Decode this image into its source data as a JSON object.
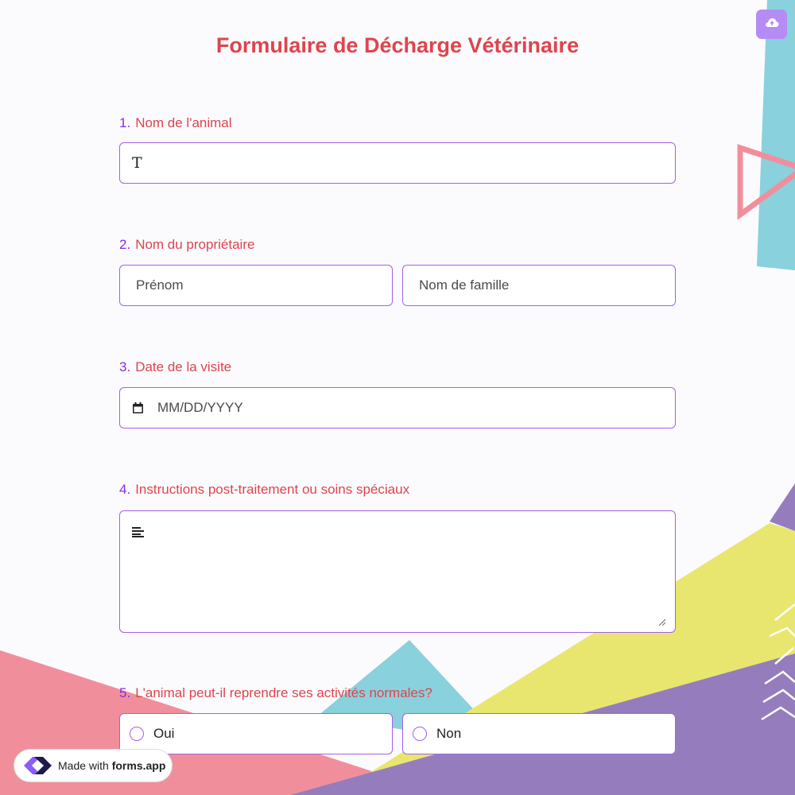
{
  "form": {
    "title": "Formulaire de Décharge Vétérinaire"
  },
  "questions": [
    {
      "number": "1.",
      "label": "Nom de l'animal"
    },
    {
      "number": "2.",
      "label": "Nom du propriétaire",
      "first_placeholder": "Prénom",
      "last_placeholder": "Nom de famille"
    },
    {
      "number": "3.",
      "label": "Date de la visite",
      "placeholder": "MM/DD/YYYY"
    },
    {
      "number": "4.",
      "label": "Instructions post-traitement ou soins spéciaux"
    },
    {
      "number": "5.",
      "label": "L'animal peut-il reprendre ses activités normales?",
      "options": [
        "Oui",
        "Non"
      ]
    }
  ],
  "branding": {
    "prefix": "Made with",
    "name": "forms.app"
  },
  "colors": {
    "accent": "#a65ee8",
    "label": "#e0434d",
    "number": "#8a2be2",
    "shape_teal": "#89d1dc",
    "shape_pink": "#f08f9b",
    "shape_yellow": "#e8e66f",
    "shape_purple": "#957dbd"
  },
  "icons": {
    "text_field": "text-t-icon",
    "date_field": "calendar-icon",
    "textarea_field": "align-left-icon",
    "upload": "cloud-upload-icon",
    "logo": "forms-app-logo-icon"
  }
}
